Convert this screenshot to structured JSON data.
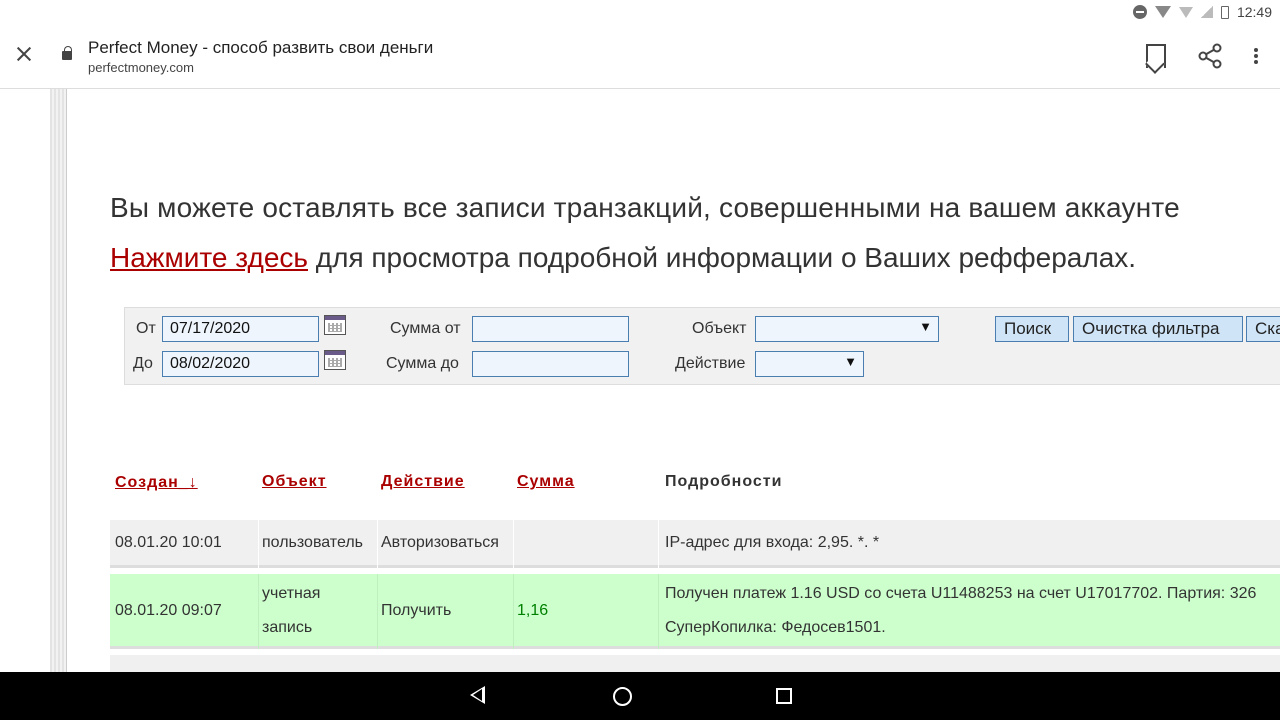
{
  "status_bar": {
    "time": "12:49",
    "icons": [
      "do-not-disturb-icon",
      "wifi-icon",
      "wifi-icon",
      "no-signal-icon",
      "battery-icon"
    ]
  },
  "browser": {
    "page_title": "Perfect Money - способ развить свои деньги",
    "url": "perfectmoney.com",
    "icons": [
      "close-icon",
      "lock-icon",
      "bookmark-icon",
      "share-icon",
      "more-vert-icon"
    ]
  },
  "page": {
    "intro_text": "Вы можете оставлять все записи транзакций, совершенными на вашем аккаунте",
    "referral_link": "Нажмите здесь",
    "referral_text": " для просмотра подробной информации о Ваших реффералах."
  },
  "filter": {
    "from_label": "От",
    "from_value": "07/17/2020",
    "to_label": "До",
    "to_value": "08/02/2020",
    "sum_from_label": "Сумма от",
    "sum_from_value": "",
    "sum_to_label": "Сумма до",
    "sum_to_value": "",
    "object_label": "Объект",
    "object_value": "",
    "action_label": "Действие",
    "action_value": "",
    "search_button": "Поиск",
    "clear_button": "Очистка фильтра",
    "download_button": "Скачать"
  },
  "table": {
    "columns": [
      "Создан_↓",
      "Объект",
      "Действие",
      "Сумма",
      "Подробности"
    ],
    "rows": [
      {
        "created": "08.01.20 10:01",
        "object": "пользователь",
        "action": "Авторизоваться",
        "amount": "",
        "details": "IP-адрес для входа: 2,95. *. *",
        "details2": ""
      },
      {
        "created": "08.01.20 09:07",
        "object": "учетная",
        "object2": "запись",
        "action": "Получить",
        "amount": "1,16",
        "details": "Получен платеж 1.16 USD со счета U11488253 на счет U17017702. Партия: 326",
        "details2": "СуперКопилка: Федосев1501."
      }
    ]
  },
  "colors": {
    "link": "#aa0000",
    "received_row": "#ccffcc",
    "amount": "#008000",
    "input_border": "#4a7db0"
  }
}
